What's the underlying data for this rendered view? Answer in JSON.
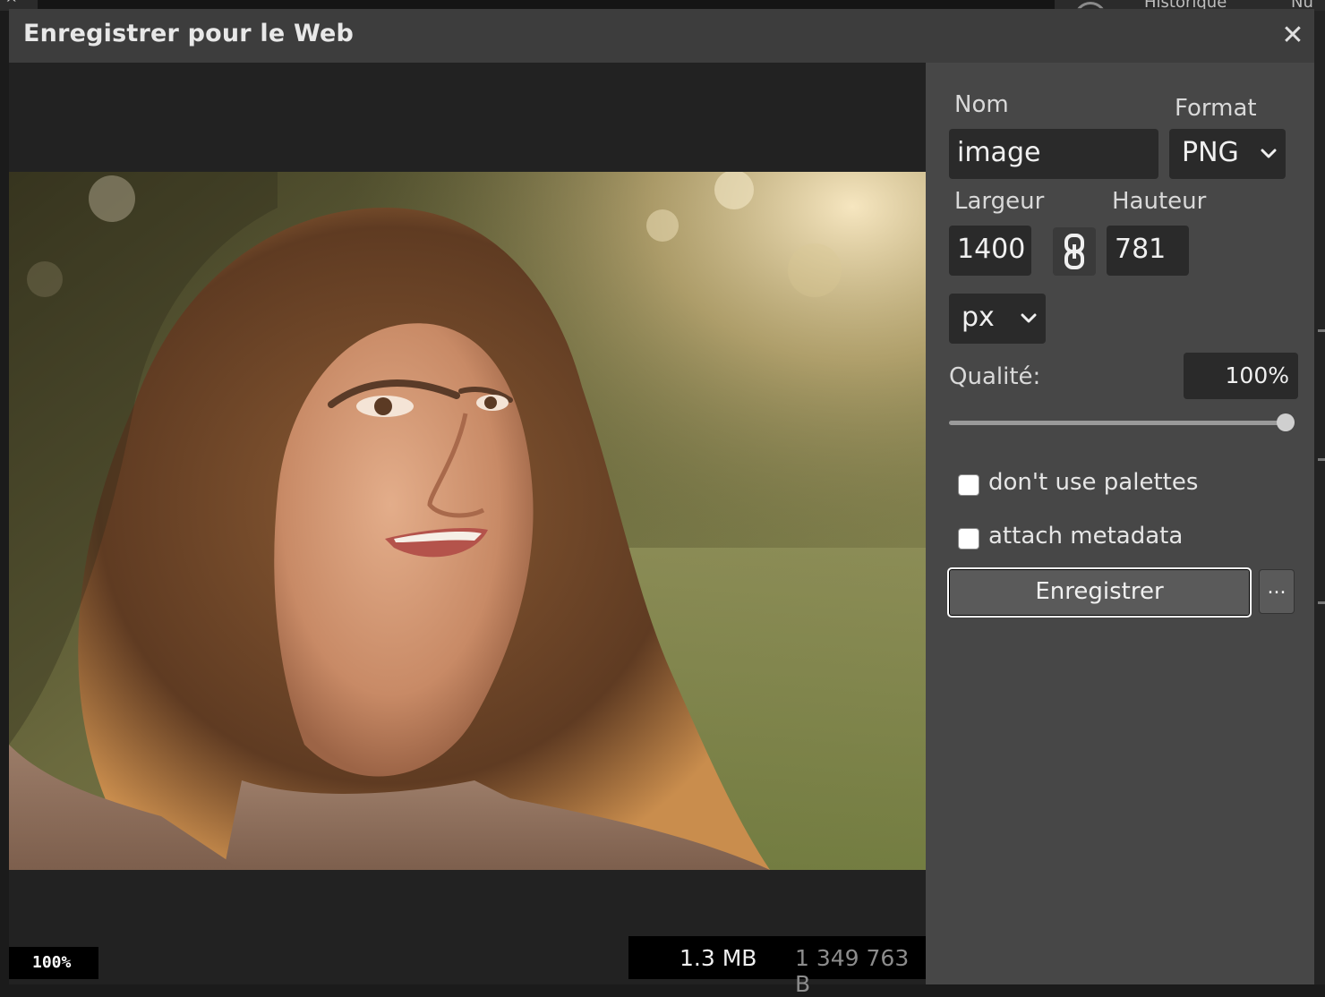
{
  "background": {
    "tabs": [
      "Historique",
      "Nu"
    ]
  },
  "dialog": {
    "title": "Enregistrer pour le Web",
    "close_icon": "close-icon"
  },
  "preview": {
    "zoom": "100%",
    "size_mb": "1.3 MB",
    "size_bytes": "1 349 763 B"
  },
  "form": {
    "name_label": "Nom",
    "name_value": "image",
    "format_label": "Format",
    "format_value": "PNG",
    "width_label": "Largeur",
    "width_value": "1400",
    "height_label": "Hauteur",
    "height_value": "781",
    "link_icon": "chain-link-icon",
    "unit_value": "px",
    "quality_label": "Qualité:",
    "quality_value": "100%",
    "quality_level": 1.0,
    "checkbox_palettes": "don't use palettes",
    "checkbox_metadata": "attach metadata",
    "save_label": "Enregistrer",
    "more_label": "..."
  },
  "colors": {
    "dialog_bg": "#474747",
    "titlebar_bg": "#3d3d3d",
    "preview_bg": "#222222",
    "field_bg": "#2a2a2a",
    "button_bg": "#5a5a5a"
  }
}
